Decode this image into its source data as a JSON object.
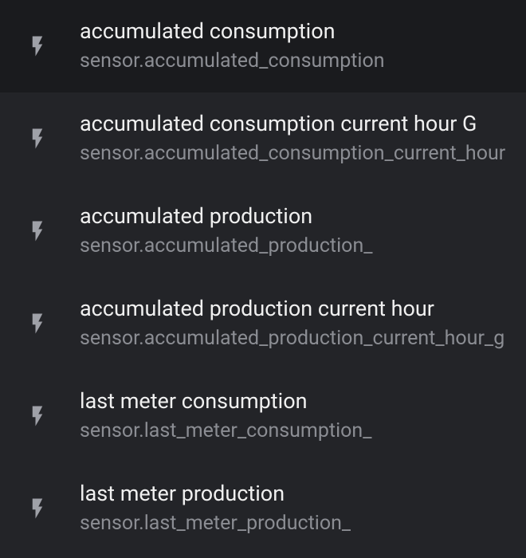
{
  "items": [
    {
      "title": "accumulated consumption",
      "subtitle": "sensor.accumulated_consumption",
      "active": true
    },
    {
      "title": "accumulated consumption current hour G",
      "subtitle": "sensor.accumulated_consumption_current_hour",
      "active": false
    },
    {
      "title": "accumulated production",
      "subtitle": "sensor.accumulated_production_",
      "active": false
    },
    {
      "title": "accumulated production current hour",
      "subtitle": "sensor.accumulated_production_current_hour_g",
      "active": false
    },
    {
      "title": "last meter consumption",
      "subtitle": "sensor.last_meter_consumption_",
      "active": false
    },
    {
      "title": "last meter production",
      "subtitle": "sensor.last_meter_production_",
      "active": false
    }
  ]
}
